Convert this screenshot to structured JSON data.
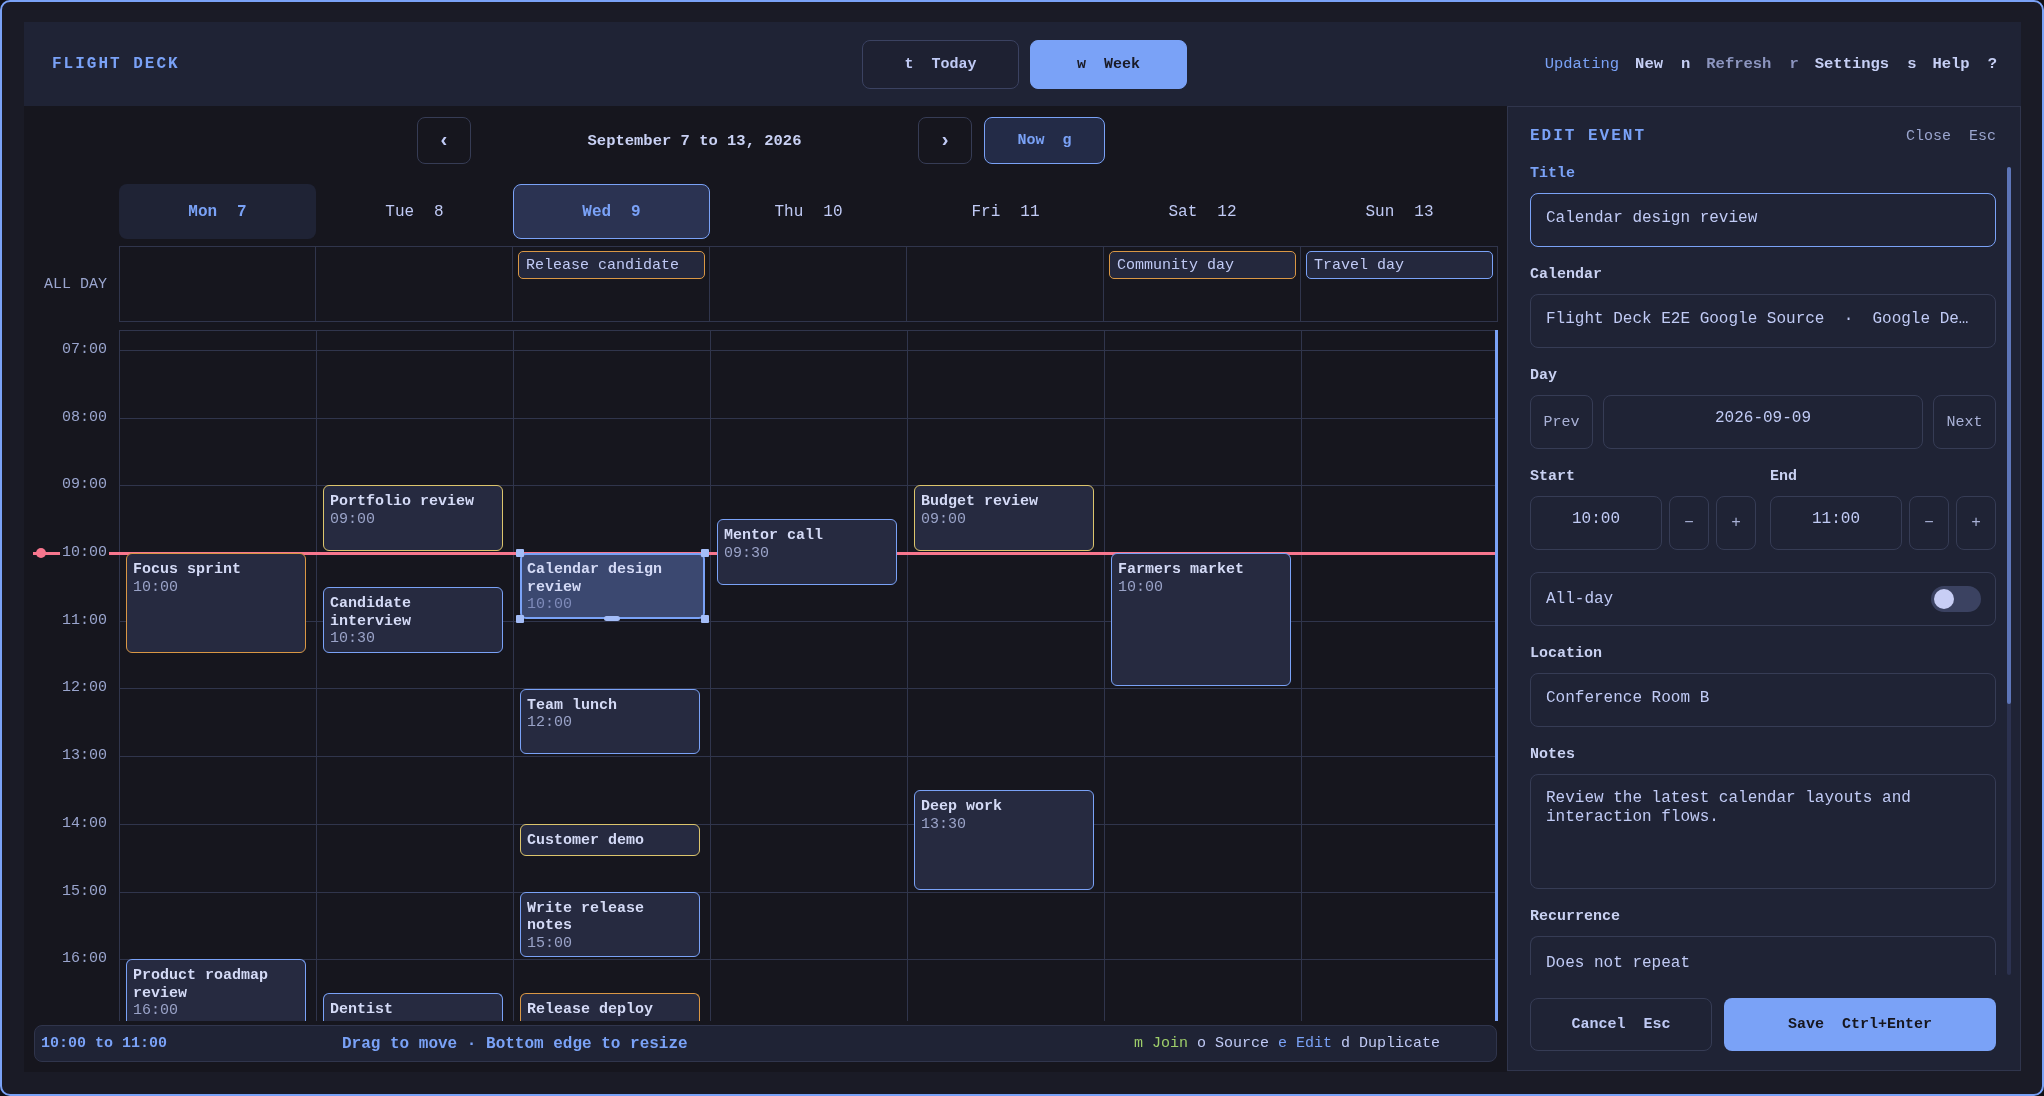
{
  "header": {
    "title": "FLIGHT DECK",
    "view_buttons": [
      {
        "key": "t",
        "label": "Today",
        "selected": false
      },
      {
        "key": "w",
        "label": "Week",
        "selected": true
      }
    ],
    "status": "Updating",
    "actions": [
      {
        "label": "New",
        "key": "n",
        "disabled": false
      },
      {
        "label": "Refresh",
        "key": "r",
        "disabled": true
      },
      {
        "label": "Settings",
        "key": "s",
        "disabled": false
      },
      {
        "label": "Help",
        "key": "?",
        "disabled": false
      }
    ]
  },
  "navigation": {
    "previous": "‹",
    "range": "September 7 to 13, 2026",
    "next": "›",
    "now_button": {
      "label": "Now",
      "key": "g"
    }
  },
  "week": {
    "all_day_label": "ALL DAY",
    "hours": [
      "07:00",
      "08:00",
      "09:00",
      "10:00",
      "11:00",
      "12:00",
      "13:00",
      "14:00",
      "15:00",
      "16:00"
    ],
    "days": [
      {
        "name": "Mon",
        "date": "7",
        "today": true,
        "selected": false,
        "events": [
          {
            "title": "Focus sprint",
            "time": "10:00",
            "color": "#d99745",
            "selected": false
          },
          {
            "title": "Product roadmap review",
            "time": "16:00",
            "color": "#7aa2f7",
            "selected": false
          }
        ]
      },
      {
        "name": "Tue",
        "date": "8",
        "today": false,
        "selected": false,
        "events": [
          {
            "title": "Portfolio review",
            "time": "09:00",
            "color": "#dcc56d",
            "selected": false
          },
          {
            "title": "Candidate interview",
            "time": "10:30",
            "color": "#7aa2f7",
            "selected": false
          },
          {
            "title": "Dentist",
            "color": "#7aa2f7",
            "selected": false
          }
        ]
      },
      {
        "name": "Wed",
        "date": "9",
        "today": false,
        "selected": true,
        "all_day": [
          {
            "title": "Release candidate",
            "color": "#d99745",
            "selected": false
          }
        ],
        "events": [
          {
            "title": "Calendar design review",
            "time": "10:00",
            "color": "#7aa2f7",
            "selected": true
          },
          {
            "title": "Team lunch",
            "time": "12:00",
            "color": "#7aa2f7",
            "selected": false
          },
          {
            "title": "Customer demo",
            "color": "#dcc56d",
            "selected": false
          },
          {
            "title": "Write release notes",
            "time": "15:00",
            "color": "#7aa2f7",
            "selected": false
          },
          {
            "title": "Release deploy",
            "color": "#d99745",
            "selected": false
          }
        ]
      },
      {
        "name": "Thu",
        "date": "10",
        "today": false,
        "selected": false,
        "events": [
          {
            "title": "Mentor call",
            "time": "09:30",
            "color": "#7aa2f7",
            "selected": false
          }
        ]
      },
      {
        "name": "Fri",
        "date": "11",
        "today": false,
        "selected": false,
        "events": [
          {
            "title": "Budget review",
            "time": "09:00",
            "color": "#dcc56d",
            "selected": false
          },
          {
            "title": "Deep work",
            "time": "13:30",
            "color": "#7aa2f7",
            "selected": false
          }
        ]
      },
      {
        "name": "Sat",
        "date": "12",
        "today": false,
        "selected": false,
        "all_day": [
          {
            "title": "Community day",
            "color": "#d99745",
            "selected": false
          }
        ],
        "events": [
          {
            "title": "Farmers market",
            "time": "10:00",
            "color": "#7aa2f7",
            "selected": false
          }
        ]
      },
      {
        "name": "Sun",
        "date": "13",
        "today": false,
        "selected": false,
        "all_day": [
          {
            "title": "Travel day",
            "color": "#7aa2f7",
            "selected": false
          }
        ]
      }
    ]
  },
  "status_bar": {
    "selection": "10:00 to 11:00",
    "hint": "Drag to move · Bottom edge to resize",
    "actions": [
      {
        "key": "m",
        "label": "Join",
        "color": "#9ece6a"
      },
      {
        "key": "o",
        "label": "Source",
        "color": "#c0caf5"
      },
      {
        "key": "e",
        "label": "Edit",
        "color": "#7aa2f7"
      },
      {
        "key": "d",
        "label": "Duplicate",
        "color": "#c0caf5"
      }
    ]
  },
  "edit_panel": {
    "heading": "EDIT EVENT",
    "close": {
      "label": "Close",
      "key": "Esc"
    },
    "title": {
      "label": "Title",
      "value": "Calendar design review",
      "focused": true
    },
    "calendar": {
      "label": "Calendar",
      "value": "Flight Deck E2E Google Source  ·  Google De…",
      "focused": false
    },
    "day": {
      "label": "Day",
      "previous": "Prev",
      "value": "2026-09-09",
      "next": "Next",
      "focused": false
    },
    "start": {
      "label": "Start",
      "value": "10:00",
      "decrement": "−",
      "increment": "+",
      "focused": false
    },
    "end": {
      "label": "End",
      "value": "11:00",
      "decrement": "−",
      "increment": "+",
      "focused": false
    },
    "all_day": {
      "label": "All-day",
      "on": false
    },
    "location": {
      "label": "Location",
      "value": "Conference Room B",
      "focused": false
    },
    "notes": {
      "label": "Notes",
      "value": "Review the latest calendar layouts and interaction flows.",
      "focused": false
    },
    "recurrence": {
      "label": "Recurrence",
      "value": "Does not repeat",
      "focused": false
    },
    "cancel": {
      "label": "Cancel",
      "key": "Esc"
    },
    "save": {
      "label": "Save",
      "key": "Ctrl+Enter"
    }
  }
}
